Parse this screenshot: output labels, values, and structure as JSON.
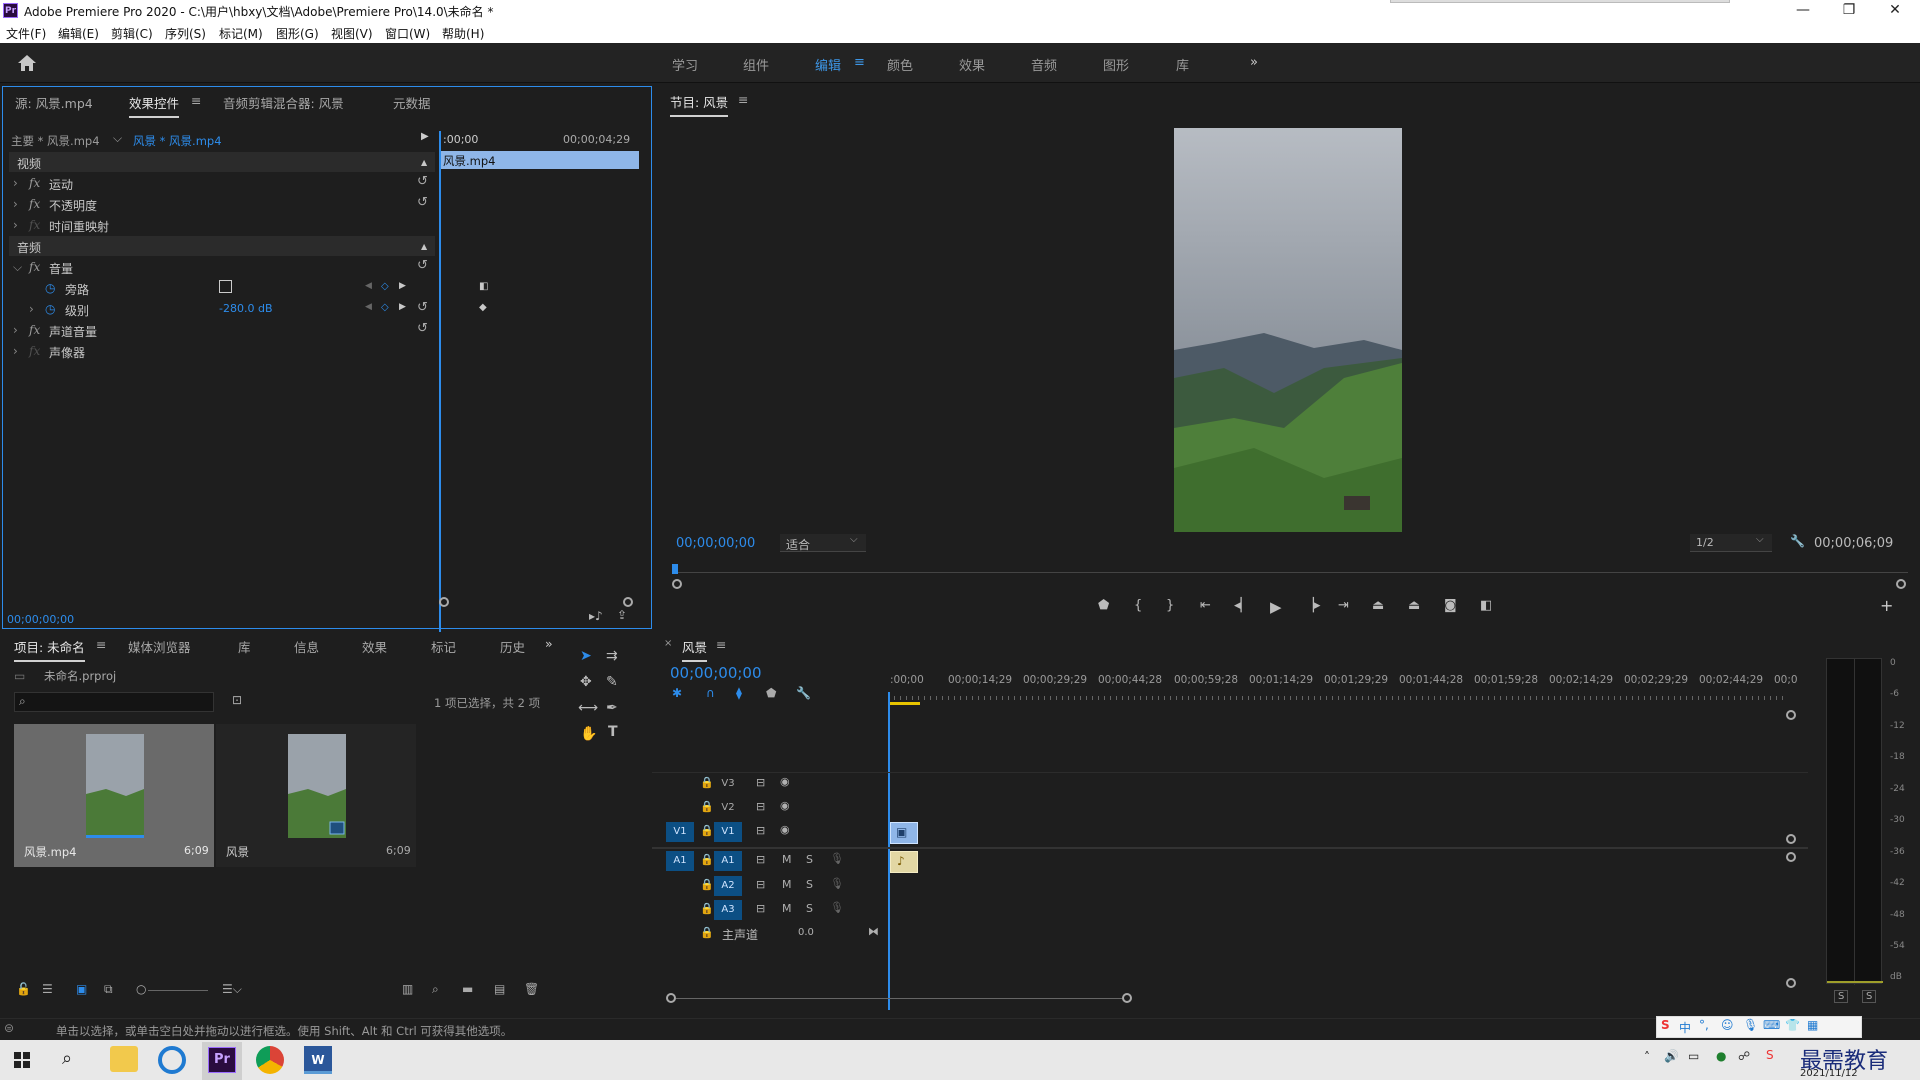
{
  "titlebar": {
    "title": "Adobe Premiere Pro 2020 - C:\\用户\\hbxy\\文档\\Adobe\\Premiere Pro\\14.0\\未命名 *",
    "icon": "Pr",
    "min": "—",
    "restore": "❐",
    "close": "✕"
  },
  "menu": [
    "文件(F)",
    "编辑(E)",
    "剪辑(C)",
    "序列(S)",
    "标记(M)",
    "图形(G)",
    "视图(V)",
    "窗口(W)",
    "帮助(H)"
  ],
  "workspaces": [
    "学习",
    "组件",
    "编辑",
    "颜色",
    "效果",
    "音频",
    "图形",
    "库"
  ],
  "workspace_active": "编辑",
  "more": "»",
  "effect_panel": {
    "tabs": [
      "源: 风景.mp4",
      "效果控件",
      "音频剪辑混合器: 风景",
      "元数据"
    ],
    "menu_icon": "≡",
    "master": "主要 * 风景.mp4",
    "clip": "风景 * 风景.mp4",
    "time_start": ":00;00",
    "time_end": "00;00;04;29",
    "clip_bar": "风景.mp4",
    "video_header": "视频",
    "audio_header": "音频",
    "fx": "fx",
    "rows": [
      "运动",
      "不透明度",
      "时间重映射",
      "音量",
      "旁路",
      "级别",
      "声道音量",
      "声像器"
    ],
    "level_value": "-280.0 dB",
    "timecode": "00;00;00;00"
  },
  "program": {
    "title": "节目: 风景",
    "timecode": "00;00;00;00",
    "fit": "适合",
    "res": "1/2",
    "duration": "00;00;06;09"
  },
  "project": {
    "tabs": [
      "项目: 未命名",
      "媒体浏览器",
      "库",
      "信息",
      "效果",
      "标记",
      "历史"
    ],
    "file": "未命名.prproj",
    "selection": "1 项已选择，共 2 项",
    "items": [
      {
        "name": "风景.mp4",
        "duration": "6;09"
      },
      {
        "name": "风景",
        "duration": "6;09"
      }
    ]
  },
  "timeline": {
    "tab": "风景",
    "timecode": "00;00;00;00",
    "ruler": [
      ":00;00",
      "00;00;14;29",
      "00;00;29;29",
      "00;00;44;28",
      "00;00;59;28",
      "00;01;14;29",
      "00;01;29;29",
      "00;01;44;28",
      "00;01;59;28",
      "00;02;14;29",
      "00;02;29;29",
      "00;02;44;29",
      "00;0"
    ],
    "video_tracks": [
      "V3",
      "V2",
      "V1"
    ],
    "audio_tracks": [
      "A1",
      "A2",
      "A3"
    ],
    "src_v": "V1",
    "src_a": "A1",
    "m": "M",
    "s": "S",
    "master": "主声道",
    "master_val": "0.0"
  },
  "meter": {
    "ticks": [
      "0",
      "-6",
      "-12",
      "-18",
      "-24",
      "-30",
      "-36",
      "-42",
      "-48",
      "-54",
      "dB"
    ],
    "solo": [
      "S",
      "S"
    ]
  },
  "status": "单击以选择，或单击空白处并拖动以进行框选。使用 Shift、Alt 和 Ctrl 可获得其他选项。",
  "tray": {
    "date": "2021/11/12",
    "watermark": "最需教育",
    "ime": "中"
  },
  "colors": {
    "accent": "#2d8ceb",
    "panel": "#1e1e1e",
    "trackbtn": "#0c4f84"
  }
}
